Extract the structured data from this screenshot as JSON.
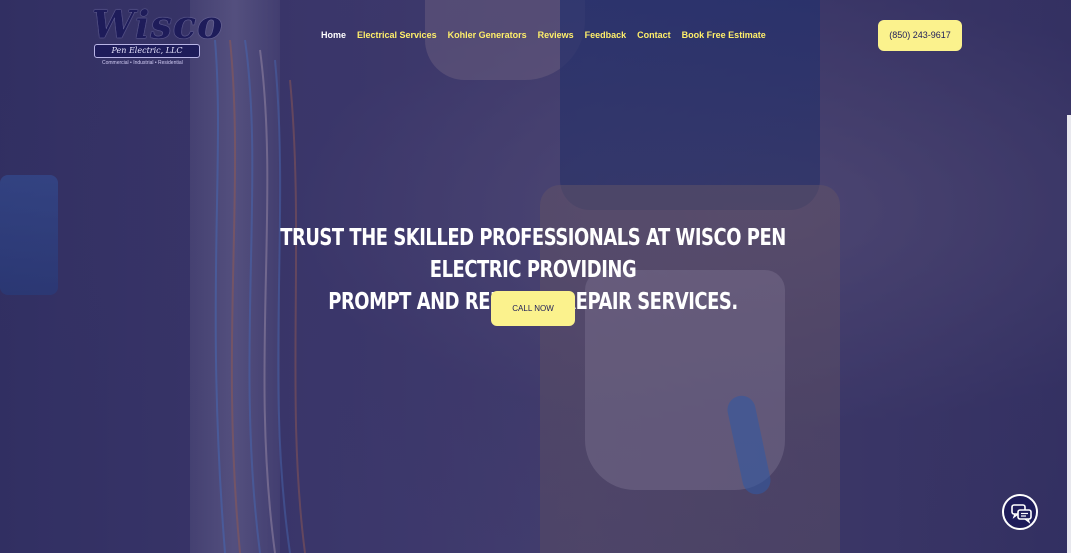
{
  "header": {
    "logo": {
      "script_text": "Wisco",
      "banner_text": "Pen Electric, LLC",
      "tagline": "Commercial • Industrial • Residential"
    },
    "nav": [
      {
        "label": "Home",
        "active": true
      },
      {
        "label": "Electrical Services",
        "active": false
      },
      {
        "label": "Kohler Generators",
        "active": false
      },
      {
        "label": "Reviews",
        "active": false
      },
      {
        "label": "Feedback",
        "active": false
      },
      {
        "label": "Contact",
        "active": false
      },
      {
        "label": "Book Free Estimate",
        "active": false
      }
    ],
    "phone_label": "(850) 243-9617"
  },
  "hero": {
    "headline_line1": "Trust the skilled professionals at Wisco Pen Electric providing",
    "headline_line2": "prompt and reliable repair services.",
    "cta_label": "Call Now"
  },
  "chat": {
    "icon": "chat-bubbles-icon"
  },
  "colors": {
    "accent_yellow": "#fbf28d",
    "nav_yellow": "#ffef6a",
    "brand_navy": "#1e1c5a"
  }
}
